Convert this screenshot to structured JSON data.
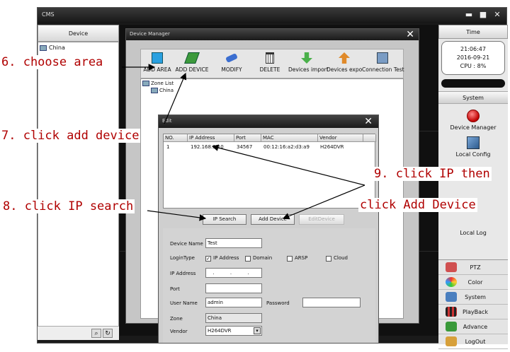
{
  "cms": {
    "title": "CMS",
    "device_header": "Device",
    "tree_root": "China",
    "time_header": "Time",
    "clock": {
      "time": "21:06:47",
      "date": "2016-09-21",
      "cpu": "CPU : 8%"
    },
    "system_header": "System",
    "right_items": [
      "Device Manager",
      "Local Config",
      "Local Log"
    ],
    "bottom_items": [
      "PTZ",
      "Color",
      "System",
      "PlayBack",
      "Advance",
      "LogOut"
    ],
    "colors": {
      "accent_red": "#c00000",
      "titlebar": "#1a1a1a"
    }
  },
  "device_manager": {
    "title": "Device Manager",
    "toolbar": [
      "ADD AREA",
      "ADD DEVICE",
      "MODIFY",
      "DELETE",
      "Devices import",
      "Devices expor",
      "Connection Test"
    ],
    "tree": {
      "root": "Zone List",
      "child": "China"
    }
  },
  "edit_dialog": {
    "title": "Edit",
    "columns": [
      "NO.",
      "IP Address",
      "Port",
      "MAC",
      "Vendor"
    ],
    "rows": [
      {
        "no": "1",
        "ip": "192.168.1.10",
        "port": "34567",
        "mac": "00:12:16:a2:d3:a9",
        "vendor": "H264DVR"
      }
    ],
    "buttons": {
      "ip_search": "IP Search",
      "add_device": "Add Device",
      "edit_device": "EditDevice"
    },
    "form": {
      "device_name_label": "Device Name",
      "device_name_value": "Test",
      "login_type_label": "LoginType",
      "login_options": [
        "IP Address",
        "Domain",
        "ARSP",
        "Cloud"
      ],
      "ip_address_label": "IP Address",
      "ip_address_value": ". . .",
      "port_label": "Port",
      "port_value": "",
      "user_name_label": "User Name",
      "user_name_value": "admin",
      "password_label": "Password",
      "password_value": "",
      "zone_label": "Zone",
      "zone_value": "China",
      "vendor_label": "Vendor",
      "vendor_value": "H264DVR"
    }
  },
  "annotations": {
    "step6": "6. choose area",
    "step7": "7. click add device",
    "step8": "8. click IP search",
    "step9a": "9. click IP then",
    "step9b": "click Add Device"
  }
}
